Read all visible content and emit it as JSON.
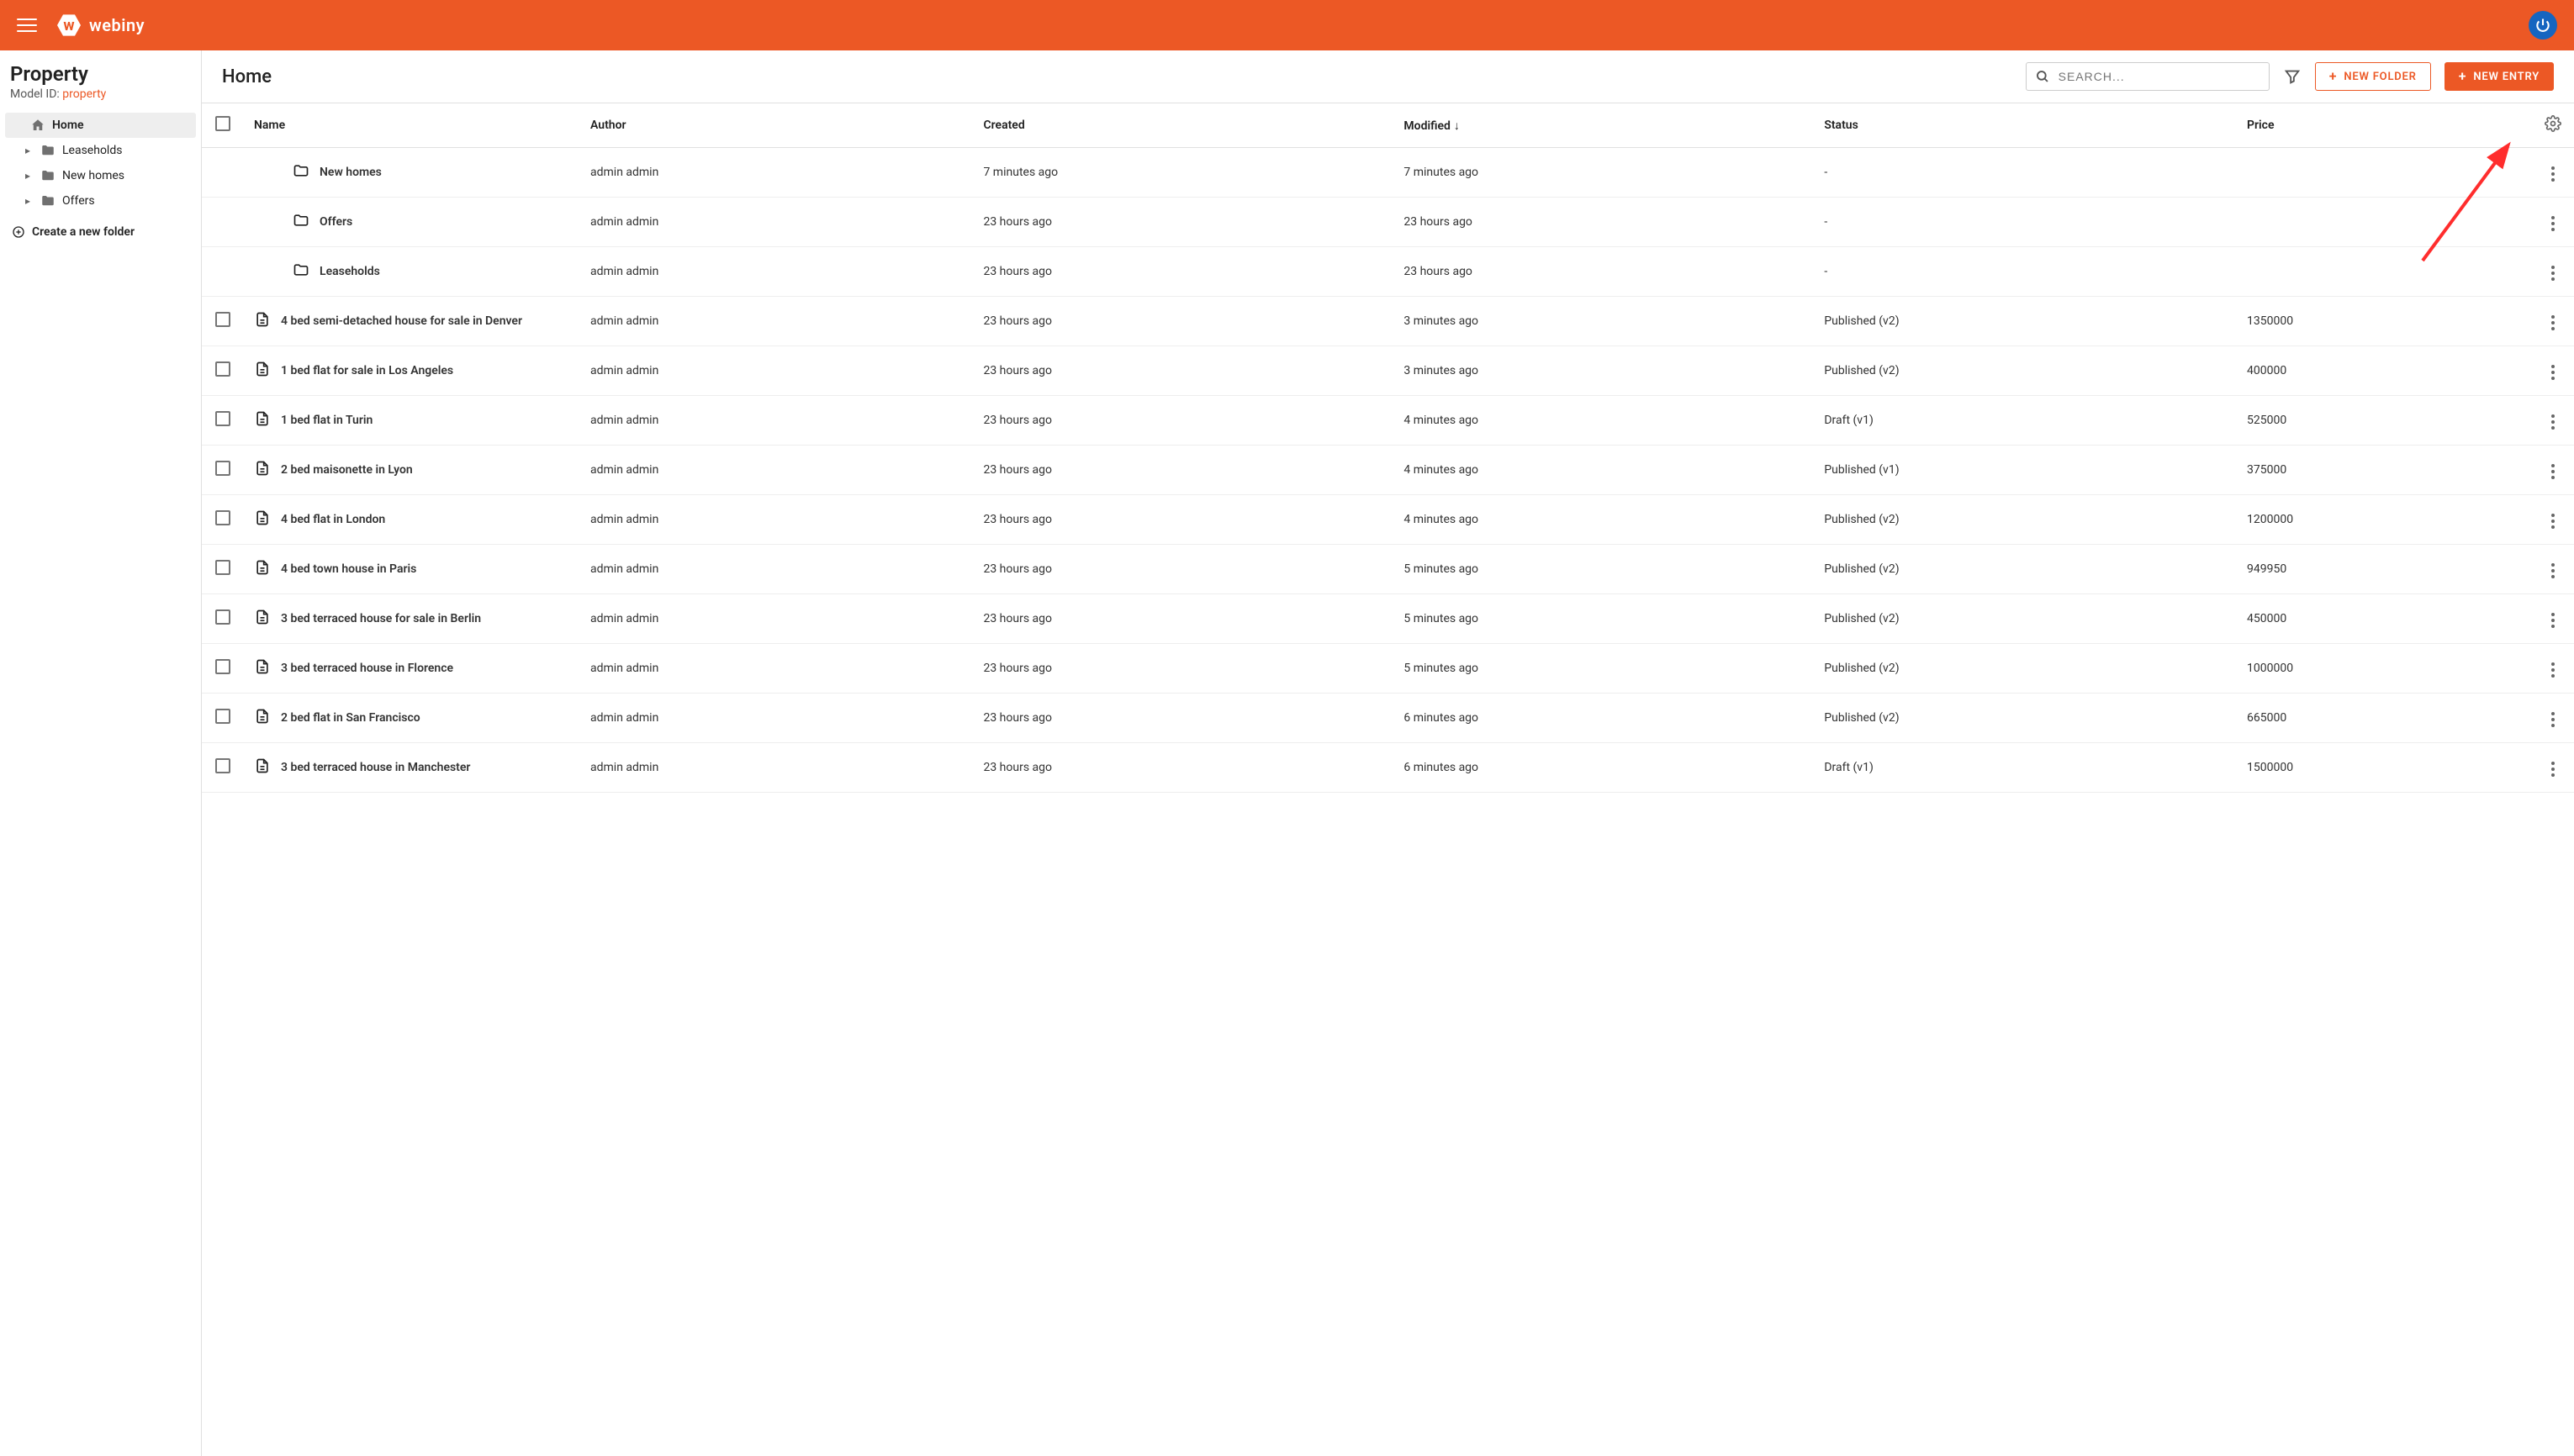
{
  "brand": {
    "name": "webiny",
    "logo_letter": "w"
  },
  "sidebar": {
    "title": "Property",
    "model_label": "Model ID:",
    "model_id": "property",
    "tree": [
      {
        "label": "Home",
        "icon": "home",
        "active": true,
        "expandable": false
      },
      {
        "label": "Leaseholds",
        "icon": "folder",
        "active": false,
        "expandable": true
      },
      {
        "label": "New homes",
        "icon": "folder",
        "active": false,
        "expandable": true
      },
      {
        "label": "Offers",
        "icon": "folder",
        "active": false,
        "expandable": true
      }
    ],
    "create_folder_label": "Create a new folder"
  },
  "page": {
    "title": "Home",
    "search_placeholder": "SEARCH...",
    "new_folder_label": "NEW FOLDER",
    "new_entry_label": "NEW ENTRY"
  },
  "columns": {
    "name": "Name",
    "author": "Author",
    "created": "Created",
    "modified": "Modified",
    "status": "Status",
    "price": "Price"
  },
  "rows": [
    {
      "type": "folder",
      "name": "New homes",
      "author": "admin admin",
      "created": "7 minutes ago",
      "modified": "7 minutes ago",
      "status": "-",
      "price": ""
    },
    {
      "type": "folder",
      "name": "Offers",
      "author": "admin admin",
      "created": "23 hours ago",
      "modified": "23 hours ago",
      "status": "-",
      "price": ""
    },
    {
      "type": "folder",
      "name": "Leaseholds",
      "author": "admin admin",
      "created": "23 hours ago",
      "modified": "23 hours ago",
      "status": "-",
      "price": ""
    },
    {
      "type": "entry",
      "name": "4 bed semi-detached house for sale in Denver",
      "author": "admin admin",
      "created": "23 hours ago",
      "modified": "3 minutes ago",
      "status": "Published (v2)",
      "price": "1350000"
    },
    {
      "type": "entry",
      "name": "1 bed flat for sale in Los Angeles",
      "author": "admin admin",
      "created": "23 hours ago",
      "modified": "3 minutes ago",
      "status": "Published (v2)",
      "price": "400000"
    },
    {
      "type": "entry",
      "name": "1 bed flat in Turin",
      "author": "admin admin",
      "created": "23 hours ago",
      "modified": "4 minutes ago",
      "status": "Draft (v1)",
      "price": "525000"
    },
    {
      "type": "entry",
      "name": "2 bed maisonette in Lyon",
      "author": "admin admin",
      "created": "23 hours ago",
      "modified": "4 minutes ago",
      "status": "Published (v1)",
      "price": "375000"
    },
    {
      "type": "entry",
      "name": "4 bed flat in London",
      "author": "admin admin",
      "created": "23 hours ago",
      "modified": "4 minutes ago",
      "status": "Published (v2)",
      "price": "1200000"
    },
    {
      "type": "entry",
      "name": "4 bed town house in Paris",
      "author": "admin admin",
      "created": "23 hours ago",
      "modified": "5 minutes ago",
      "status": "Published (v2)",
      "price": "949950"
    },
    {
      "type": "entry",
      "name": "3 bed terraced house for sale in Berlin",
      "author": "admin admin",
      "created": "23 hours ago",
      "modified": "5 minutes ago",
      "status": "Published (v2)",
      "price": "450000"
    },
    {
      "type": "entry",
      "name": "3 bed terraced house in Florence",
      "author": "admin admin",
      "created": "23 hours ago",
      "modified": "5 minutes ago",
      "status": "Published (v2)",
      "price": "1000000"
    },
    {
      "type": "entry",
      "name": "2 bed flat in San Francisco",
      "author": "admin admin",
      "created": "23 hours ago",
      "modified": "6 minutes ago",
      "status": "Published (v2)",
      "price": "665000"
    },
    {
      "type": "entry",
      "name": "3 bed terraced house in Manchester",
      "author": "admin admin",
      "created": "23 hours ago",
      "modified": "6 minutes ago",
      "status": "Draft (v1)",
      "price": "1500000"
    }
  ]
}
